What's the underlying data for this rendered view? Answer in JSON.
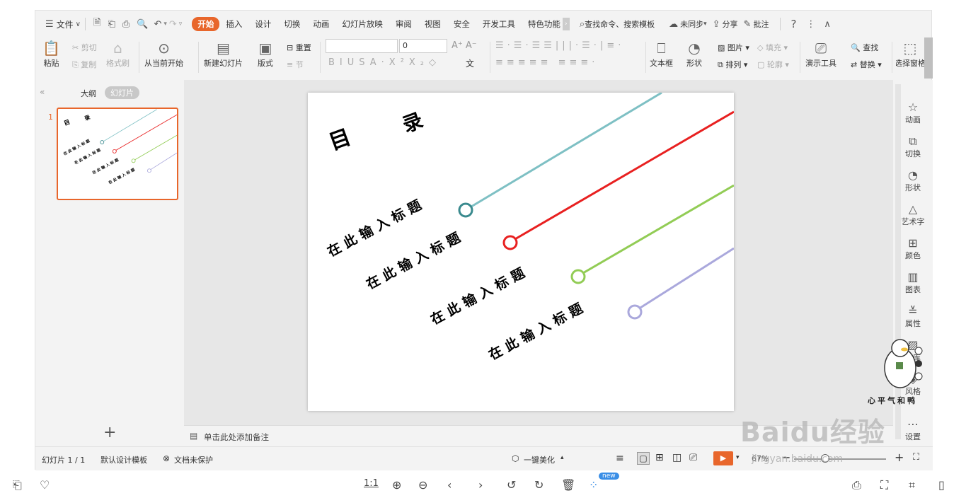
{
  "menubar": {
    "file": "文件",
    "tabs": [
      "开始",
      "插入",
      "设计",
      "切换",
      "动画",
      "幻灯片放映",
      "审阅",
      "视图",
      "安全",
      "开发工具",
      "特色功能"
    ],
    "search": "查找命令、搜索模板",
    "sync": "未同步",
    "share": "分享",
    "comment": "批注"
  },
  "ribbon": {
    "paste": "粘贴",
    "cut": "剪切",
    "copy": "复制",
    "format_painter": "格式刷",
    "play_from_current": "从当前开始",
    "new_slide": "新建幻灯片",
    "layout": "版式",
    "reset": "重置",
    "section": "节",
    "font_size": "0",
    "textbox": "文本框",
    "shape": "形状",
    "picture": "图片",
    "fill": "填充",
    "arrange": "排列",
    "outline": "轮廓",
    "presenter_tools": "演示工具",
    "find": "查找",
    "replace": "替换",
    "select_pane": "选择窗格"
  },
  "leftpanel": {
    "outline": "大纲",
    "slides": "幻灯片",
    "slide_number": "1",
    "add": "+"
  },
  "slide": {
    "title_left": "目",
    "title_right": "录",
    "items": [
      "在 此 输 入 标 题",
      "在 此 输 入 标 题",
      "在 此 输 入 标 题",
      "在 此 输 入 标 题"
    ],
    "colors": [
      "#7ec0c4",
      "#e82020",
      "#92cc55",
      "#aaa8dc"
    ],
    "circle_colors": [
      "#3a8a8e",
      "#e82020",
      "#92cc55",
      "#aaa8dc"
    ]
  },
  "notes": {
    "placeholder": "单击此处添加备注"
  },
  "rightpanel": [
    "动画",
    "切换",
    "形状",
    "艺术字",
    "颜色",
    "图表",
    "属性",
    "图库",
    "风格",
    "设置"
  ],
  "status": {
    "slide": "幻灯片 1 / 1",
    "template": "默认设计模板",
    "protect": "文档未保护",
    "beautify": "一键美化",
    "zoom": "67%"
  },
  "bottombar": {
    "ratio": "1:1",
    "new_badge": "new"
  },
  "watermark": {
    "brand": "Baidu经验",
    "url": "jingyan.baidu.com",
    "sticker": "心平气和鸭"
  }
}
